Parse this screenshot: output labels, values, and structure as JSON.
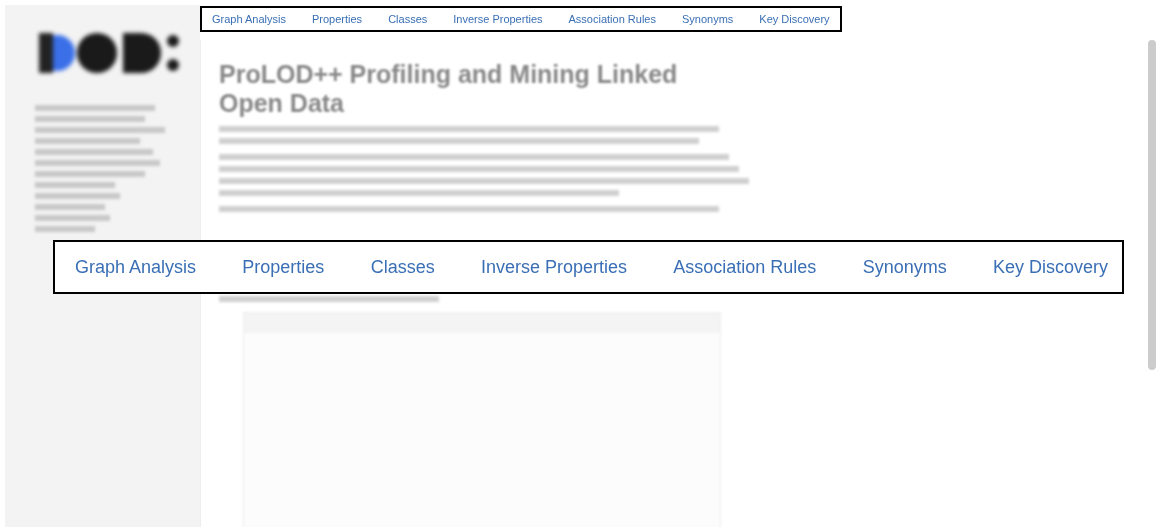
{
  "nav": {
    "links": [
      "Graph Analysis",
      "Properties",
      "Classes",
      "Inverse Properties",
      "Association Rules",
      "Synonyms",
      "Key Discovery"
    ]
  },
  "main": {
    "title": "ProLOD++ Profiling and Mining Linked Open Data"
  },
  "callout": {
    "links": [
      "Graph Analysis",
      "Properties",
      "Classes",
      "Inverse Properties",
      "Association Rules",
      "Synonyms",
      "Key Discovery"
    ]
  }
}
